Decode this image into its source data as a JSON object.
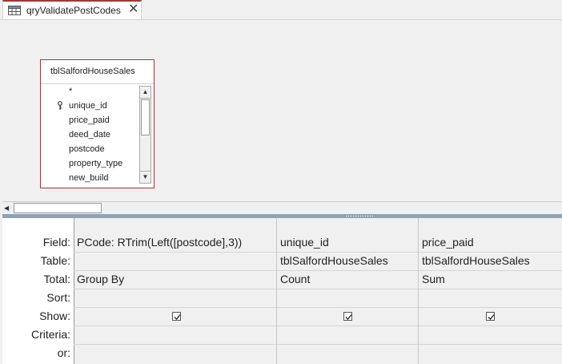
{
  "tab": {
    "title": "qryValidatePostCodes",
    "close_glyph": "✕"
  },
  "table_box": {
    "title": "tblSalfordHouseSales",
    "fields": [
      "*",
      "unique_id",
      "price_paid",
      "deed_date",
      "postcode",
      "property_type",
      "new_build"
    ],
    "primary_key_field": "unique_id"
  },
  "grid": {
    "row_labels": [
      "Field:",
      "Table:",
      "Total:",
      "Sort:",
      "Show:",
      "Criteria:",
      "or:"
    ],
    "columns": [
      {
        "field": "PCode: RTrim(Left([postcode],3))",
        "table": "",
        "total": "Group By",
        "sort": "",
        "show": true,
        "criteria": "",
        "or": ""
      },
      {
        "field": "unique_id",
        "table": "tblSalfordHouseSales",
        "total": "Count",
        "sort": "",
        "show": true,
        "criteria": "",
        "or": ""
      },
      {
        "field": "price_paid",
        "table": "tblSalfordHouseSales",
        "total": "Sum",
        "sort": "",
        "show": true,
        "criteria": "",
        "or": ""
      }
    ]
  },
  "colors": {
    "accent": "#a4373a",
    "splitter": "#8fa3b8"
  }
}
